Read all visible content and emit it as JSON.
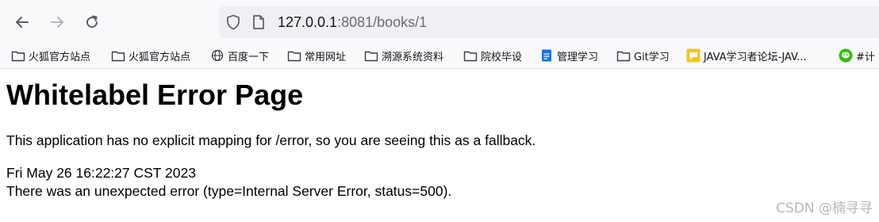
{
  "browser": {
    "url_host": "127.0.0.1",
    "url_rest": ":8081/books/1"
  },
  "bookmarks": [
    {
      "label": "火狐官方站点",
      "icon": "folder-icon"
    },
    {
      "label": "火狐官方站点",
      "icon": "folder-icon"
    },
    {
      "label": "百度一下",
      "icon": "globe-icon"
    },
    {
      "label": "常用网址",
      "icon": "folder-icon"
    },
    {
      "label": "溯源系统资料",
      "icon": "folder-icon"
    },
    {
      "label": "院校毕设",
      "icon": "folder-icon"
    },
    {
      "label": "管理学习",
      "icon": "doc-icon"
    },
    {
      "label": "Git学习",
      "icon": "folder-icon"
    },
    {
      "label": "JAVA学习者论坛-JAV...",
      "icon": "forum-icon"
    },
    {
      "label": "#计",
      "icon": "wechat-icon"
    }
  ],
  "page": {
    "title": "Whitelabel Error Page",
    "message": "This application has no explicit mapping for /error, so you are seeing this as a fallback.",
    "timestamp": "Fri May 26 16:22:27 CST 2023",
    "detail": "There was an unexpected error (type=Internal Server Error, status=500)."
  },
  "watermark": "CSDN @楠寻寻",
  "colors": {
    "toolbar_bg": "#f9f9fb",
    "urlbar_bg": "#f0f0f4",
    "doc_icon": "#1a73e8",
    "forum_icon": "#f5c518",
    "wechat_icon": "#2dc100"
  }
}
